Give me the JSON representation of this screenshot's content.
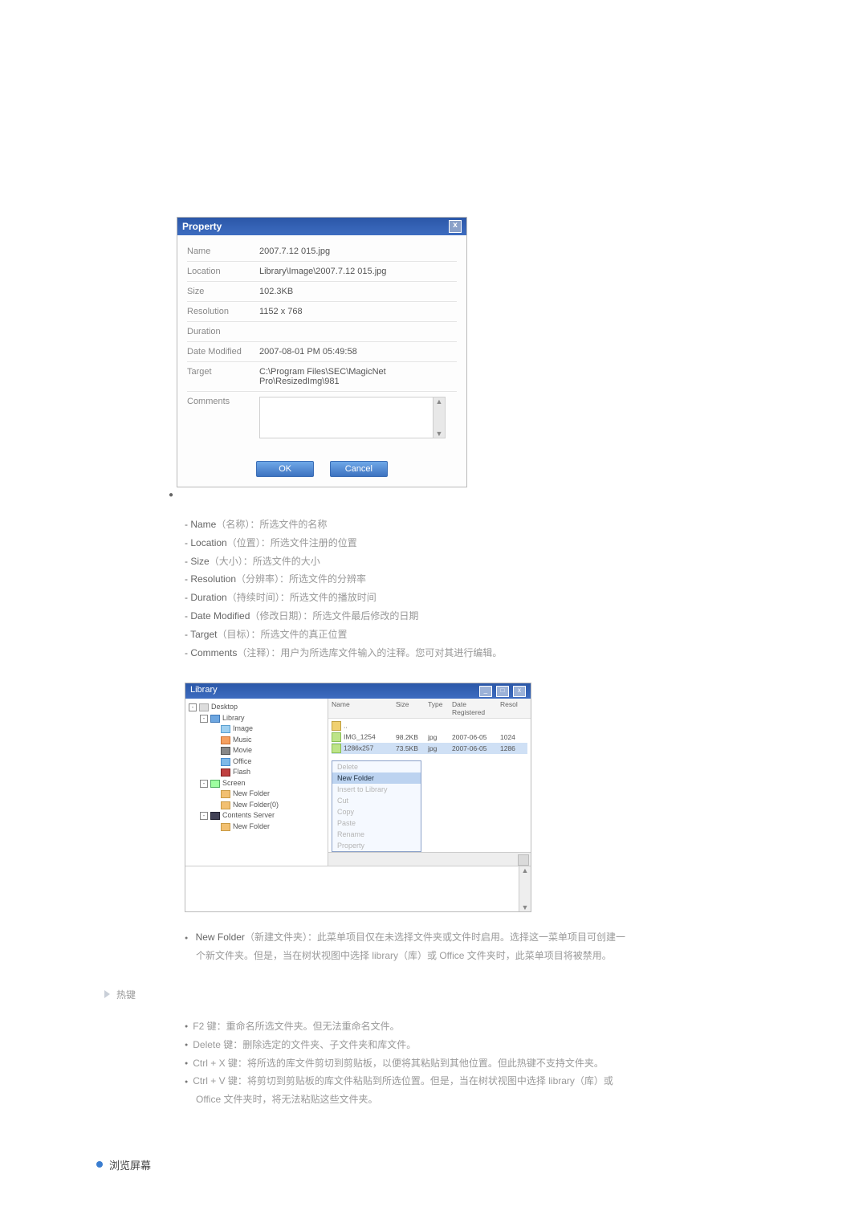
{
  "property_dialog": {
    "title": "Property",
    "fields": {
      "name_label": "Name",
      "name_value": "2007.7.12 015.jpg",
      "location_label": "Location",
      "location_value": "Library\\Image\\2007.7.12 015.jpg",
      "size_label": "Size",
      "size_value": "102.3KB",
      "resolution_label": "Resolution",
      "resolution_value": "1152 x 768",
      "duration_label": "Duration",
      "duration_value": "",
      "date_modified_label": "Date Modified",
      "date_modified_value": "2007-08-01 PM 05:49:58",
      "target_label": "Target",
      "target_value": "C:\\Program Files\\SEC\\MagicNet Pro\\ResizedImg\\981",
      "comments_label": "Comments"
    },
    "buttons": {
      "ok": "OK",
      "cancel": "Cancel"
    }
  },
  "definitions": [
    {
      "dash": "- ",
      "term": "Name",
      "zh": "（名称）：所选文件的名称"
    },
    {
      "dash": "- ",
      "term": "Location",
      "zh": "（位置）：所选文件注册的位置"
    },
    {
      "dash": "- ",
      "term": "Size",
      "zh": "（大小）：所选文件的大小"
    },
    {
      "dash": "- ",
      "term": "Resolution",
      "zh": "（分辨率）：所选文件的分辨率"
    },
    {
      "dash": "- ",
      "term": "Duration",
      "zh": "（持续时间）：所选文件的播放时间"
    },
    {
      "dash": "- ",
      "term": "Date Modified",
      "zh": "（修改日期）：所选文件最后修改的日期"
    },
    {
      "dash": "- ",
      "term": "Target",
      "zh": "（目标）：所选文件的真正位置"
    },
    {
      "dash": "- ",
      "term": "Comments",
      "zh": "（注释）：用户为所选库文件输入的注释。您可对其进行编辑。"
    }
  ],
  "library_window": {
    "title": "Library",
    "tree": [
      {
        "lvl": 0,
        "icon": "ic-desk",
        "pm": "-",
        "label": "Desktop"
      },
      {
        "lvl": 1,
        "icon": "ic-folder-blue",
        "pm": "-",
        "label": "Library"
      },
      {
        "lvl": 2,
        "icon": "ic-img",
        "pm": "",
        "label": "Image"
      },
      {
        "lvl": 2,
        "icon": "ic-mus",
        "pm": "",
        "label": "Music"
      },
      {
        "lvl": 2,
        "icon": "ic-mov",
        "pm": "",
        "label": "Movie"
      },
      {
        "lvl": 2,
        "icon": "ic-off",
        "pm": "",
        "label": "Office"
      },
      {
        "lvl": 2,
        "icon": "ic-flash",
        "pm": "",
        "label": "Flash"
      },
      {
        "lvl": 1,
        "icon": "ic-scr",
        "pm": "-",
        "label": "Screen"
      },
      {
        "lvl": 2,
        "icon": "ic-folder",
        "pm": "",
        "label": "New Folder"
      },
      {
        "lvl": 2,
        "icon": "ic-folder",
        "pm": "",
        "label": "New Folder(0)"
      },
      {
        "lvl": 1,
        "icon": "ic-serv",
        "pm": "-",
        "label": "Contents Server"
      },
      {
        "lvl": 2,
        "icon": "ic-folder",
        "pm": "",
        "label": "New Folder"
      }
    ],
    "columns": {
      "name": "Name",
      "size": "Size",
      "type": "Type",
      "date": "Date Registered",
      "res": "Resol"
    },
    "rows": [
      {
        "name": "..",
        "selected": false,
        "upicon": true
      },
      {
        "name": "IMG_1254",
        "size": "98.2KB",
        "type": "jpg",
        "date": "2007-06-05",
        "res": "1024",
        "selected": false
      },
      {
        "name": "1286x257",
        "size": "73.5KB",
        "type": "jpg",
        "date": "2007-06-05",
        "res": "1286",
        "selected": true
      }
    ],
    "context_menu": {
      "items": [
        {
          "label": "Delete",
          "dim": true
        },
        {
          "label": "New Folder",
          "active": true
        },
        {
          "label": "Insert to Library",
          "dim": true
        },
        {
          "label": "Cut",
          "dim": true
        },
        {
          "label": "Copy",
          "dim": true
        },
        {
          "label": "Paste",
          "dim": true
        },
        {
          "label": "Rename",
          "dim": true
        },
        {
          "label": "Property",
          "dim": true
        }
      ]
    }
  },
  "new_folder_text": {
    "bullet_term": "New Folder",
    "bullet_zh": "（新建文件夹）：此菜单项目仅在未选择文件夹或文件时启用。选择这一菜单项目可创建一",
    "cont": "个新文件夹。但是，当在树状视图中选择 library（库）或 Office 文件夹时，此菜单项目将被禁用。"
  },
  "hotkeys_title": "热键",
  "hotkeys": [
    {
      "line": "F2 键：重命名所选文件夹。但无法重命名文件。"
    },
    {
      "line": "Delete 键：删除选定的文件夹、子文件夹和库文件。"
    },
    {
      "line": "Ctrl + X 键：将所选的库文件剪切到剪贴板，以便将其粘贴到其他位置。但此热键不支持文件夹。"
    },
    {
      "line": "Ctrl + V 键：将剪切到剪贴板的库文件粘贴到所选位置。但是，当在树状视图中选择 library（库）或"
    },
    {
      "lineCont": "Office 文件夹时，将无法粘贴这些文件夹。"
    }
  ],
  "browse_title": "浏览屏幕"
}
